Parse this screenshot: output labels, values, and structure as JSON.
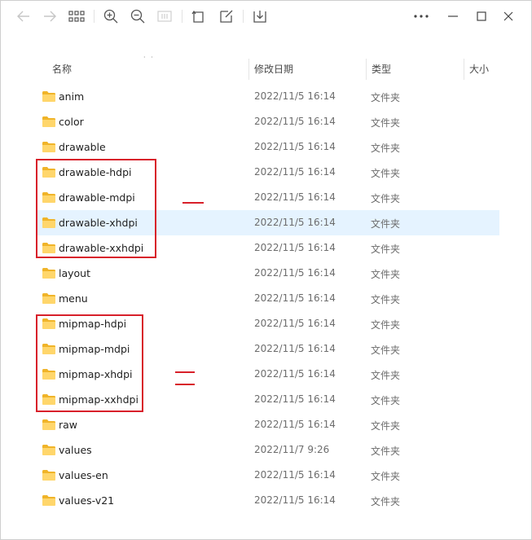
{
  "toolbar": {
    "back": "back-arrow-icon",
    "forward": "forward-arrow-icon",
    "view": "grid-view-icon",
    "zoom_in": "zoom-in-icon",
    "zoom_out": "zoom-out-icon",
    "fit": "fit-icon",
    "rotate": "rotate-icon",
    "edit": "edit-icon",
    "download": "download-icon",
    "more": "more-icon",
    "minimize": "minimize-icon",
    "maximize": "maximize-icon",
    "close": "close-icon"
  },
  "columns": {
    "name": "名称",
    "modified": "修改日期",
    "type": "类型",
    "size": "大小"
  },
  "rows": [
    {
      "name": "anim",
      "date": "2022/11/5 16:14",
      "type": "文件夹"
    },
    {
      "name": "color",
      "date": "2022/11/5 16:14",
      "type": "文件夹"
    },
    {
      "name": "drawable",
      "date": "2022/11/5 16:14",
      "type": "文件夹"
    },
    {
      "name": "drawable-hdpi",
      "date": "2022/11/5 16:14",
      "type": "文件夹"
    },
    {
      "name": "drawable-mdpi",
      "date": "2022/11/5 16:14",
      "type": "文件夹"
    },
    {
      "name": "drawable-xhdpi",
      "date": "2022/11/5 16:14",
      "type": "文件夹"
    },
    {
      "name": "drawable-xxhdpi",
      "date": "2022/11/5 16:14",
      "type": "文件夹"
    },
    {
      "name": "layout",
      "date": "2022/11/5 16:14",
      "type": "文件夹"
    },
    {
      "name": "menu",
      "date": "2022/11/5 16:14",
      "type": "文件夹"
    },
    {
      "name": "mipmap-hdpi",
      "date": "2022/11/5 16:14",
      "type": "文件夹"
    },
    {
      "name": "mipmap-mdpi",
      "date": "2022/11/5 16:14",
      "type": "文件夹"
    },
    {
      "name": "mipmap-xhdpi",
      "date": "2022/11/5 16:14",
      "type": "文件夹"
    },
    {
      "name": "mipmap-xxhdpi",
      "date": "2022/11/5 16:14",
      "type": "文件夹"
    },
    {
      "name": "raw",
      "date": "2022/11/5 16:14",
      "type": "文件夹"
    },
    {
      "name": "values",
      "date": "2022/11/7 9:26",
      "type": "文件夹"
    },
    {
      "name": "values-en",
      "date": "2022/11/5 16:14",
      "type": "文件夹"
    },
    {
      "name": "values-v21",
      "date": "2022/11/5 16:14",
      "type": "文件夹"
    }
  ],
  "selected_row": "drawable-xhdpi",
  "colors": {
    "annotation": "#d8202a",
    "selection": "#e5f3ff",
    "folder": "#f5c842"
  }
}
